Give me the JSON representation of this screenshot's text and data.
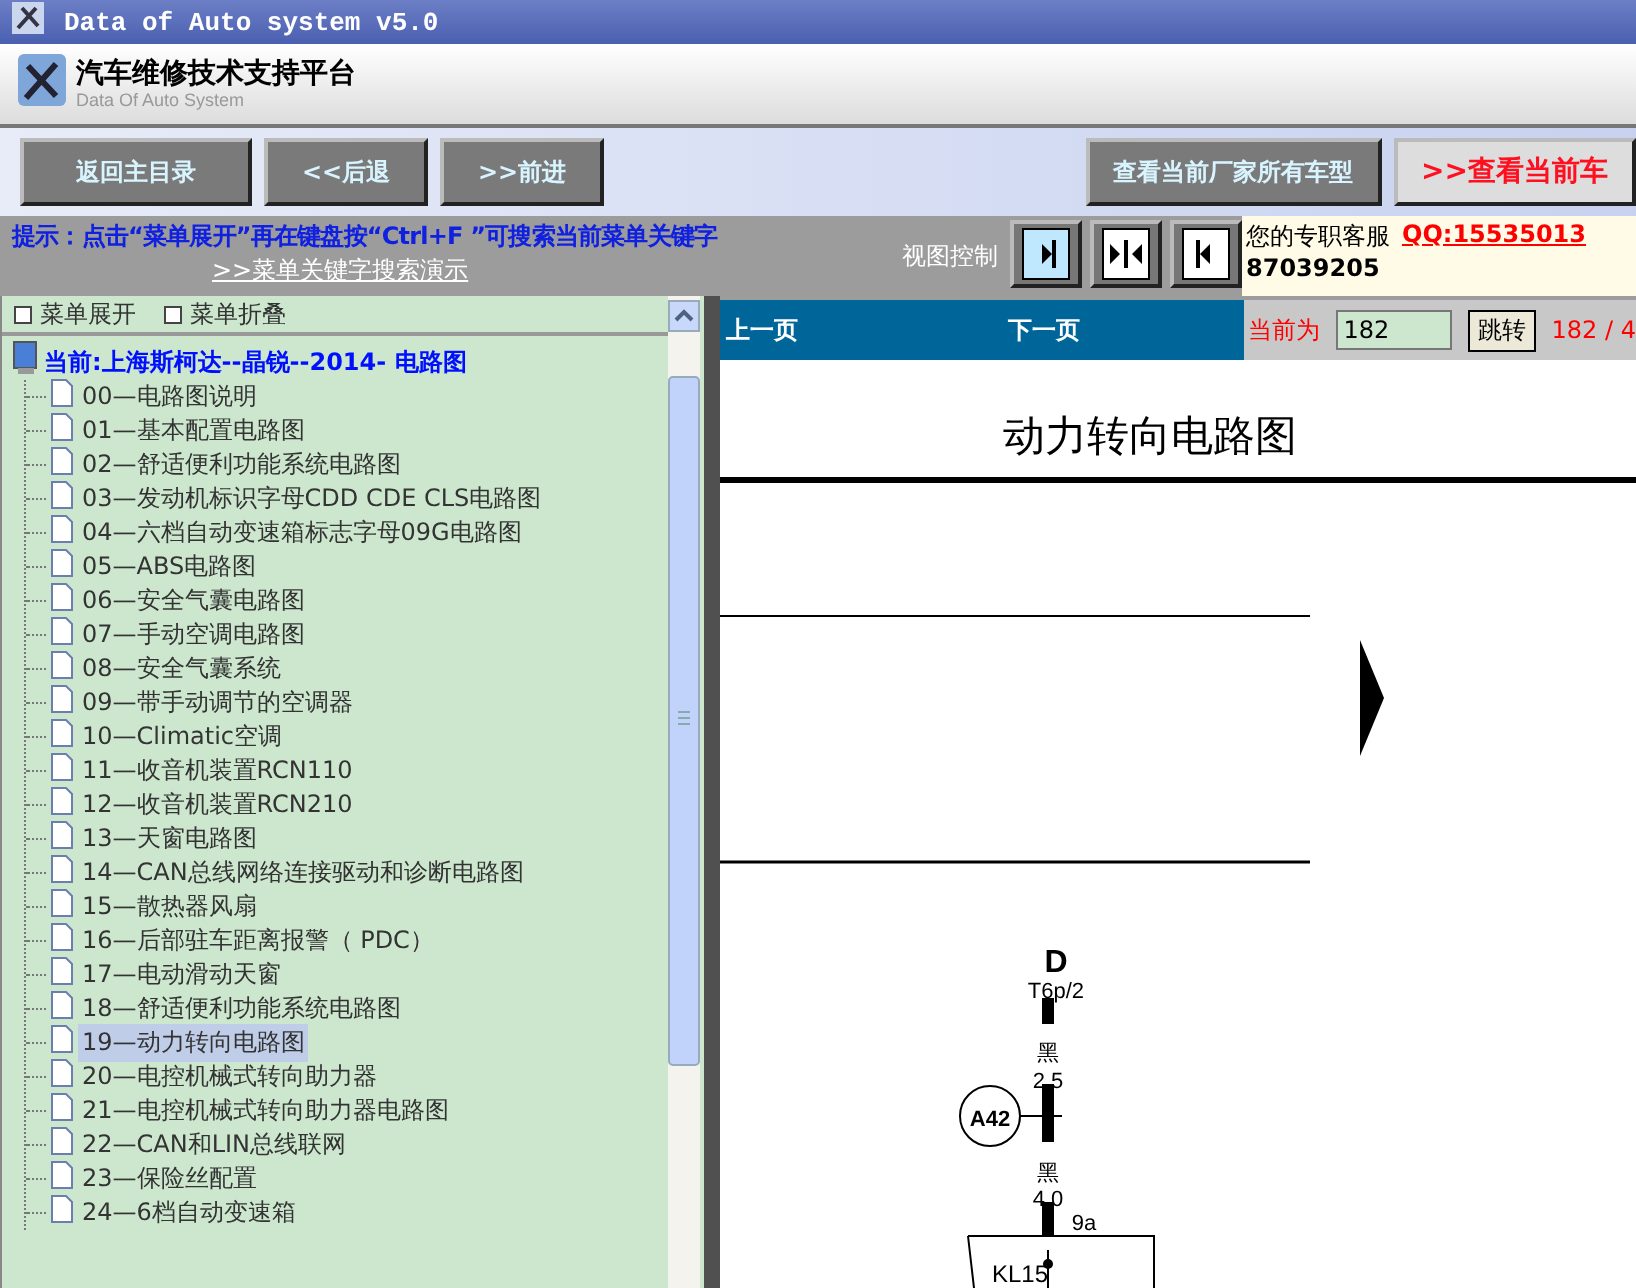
{
  "window": {
    "title": "Data of Auto system v5.0"
  },
  "header": {
    "title": "汽车维修技术支持平台",
    "subtitle": "Data Of Auto System"
  },
  "toolbar": {
    "left_buttons": [
      "返回主目录",
      "<<后退",
      ">>前进"
    ],
    "right_buttons": [
      {
        "label": "查看当前厂家所有车型",
        "kind": "normal"
      },
      {
        "label": ">>查看当前车",
        "kind": "highlight"
      }
    ]
  },
  "hint": {
    "text": "提示：点击“菜单展开”再在键盘按“Ctrl+F ”可搜索当前菜单关键字",
    "link": ">>菜单关键字搜索演示",
    "view_label": "视图控制",
    "view_buttons": [
      {
        "kind": "right",
        "selected": true
      },
      {
        "kind": "both",
        "selected": false
      },
      {
        "kind": "left",
        "selected": false
      }
    ]
  },
  "support": {
    "label": "您的专职客服",
    "qq": "QQ:15535013",
    "number": "87039205"
  },
  "menu_controls": [
    "菜单展开",
    "菜单折叠"
  ],
  "tree": {
    "root": "当前:上海斯柯达--晶锐--2014- 电路图",
    "items": [
      {
        "label": "00—电路图说明",
        "selected": false
      },
      {
        "label": "01—基本配置电路图",
        "selected": false
      },
      {
        "label": "02—舒适便利功能系统电路图",
        "selected": false
      },
      {
        "label": "03—发动机标识字母CDD CDE CLS电路图",
        "selected": false
      },
      {
        "label": "04—六档自动变速箱标志字母09G电路图",
        "selected": false
      },
      {
        "label": "05—ABS电路图",
        "selected": false
      },
      {
        "label": "06—安全气囊电路图",
        "selected": false
      },
      {
        "label": "07—手动空调电路图",
        "selected": false
      },
      {
        "label": "08—安全气囊系统",
        "selected": false
      },
      {
        "label": "09—带手动调节的空调器",
        "selected": false
      },
      {
        "label": "10—Climatic空调",
        "selected": false
      },
      {
        "label": "11—收音机装置RCN110",
        "selected": false
      },
      {
        "label": "12—收音机装置RCN210",
        "selected": false
      },
      {
        "label": "13—天窗电路图",
        "selected": false
      },
      {
        "label": "14—CAN总线网络连接驱动和诊断电路图",
        "selected": false
      },
      {
        "label": "15—散热器风扇",
        "selected": false
      },
      {
        "label": "16—后部驻车距离报警（ PDC）",
        "selected": false
      },
      {
        "label": "17—电动滑动天窗",
        "selected": false
      },
      {
        "label": "18—舒适便利功能系统电路图",
        "selected": false
      },
      {
        "label": "19—动力转向电路图",
        "selected": true
      },
      {
        "label": "20—电控机械式转向助力器",
        "selected": false
      },
      {
        "label": "21—电控机械式转向助力器电路图",
        "selected": false
      },
      {
        "label": "22—CAN和LIN总线联网",
        "selected": false
      },
      {
        "label": "23—保险丝配置",
        "selected": false
      },
      {
        "label": "24—6档自动变速箱",
        "selected": false
      }
    ]
  },
  "pager": {
    "prev": "上一页",
    "next": "下一页",
    "current_label": "当前为",
    "page_value": "182",
    "jump": "跳转",
    "count": "182 / 4"
  },
  "document": {
    "title": "动力转向电路图",
    "diagram_labels": [
      "D",
      "T6p/2",
      "黑",
      "2.5",
      "A42",
      "黑",
      "4.0",
      "9a",
      "KL15"
    ]
  }
}
